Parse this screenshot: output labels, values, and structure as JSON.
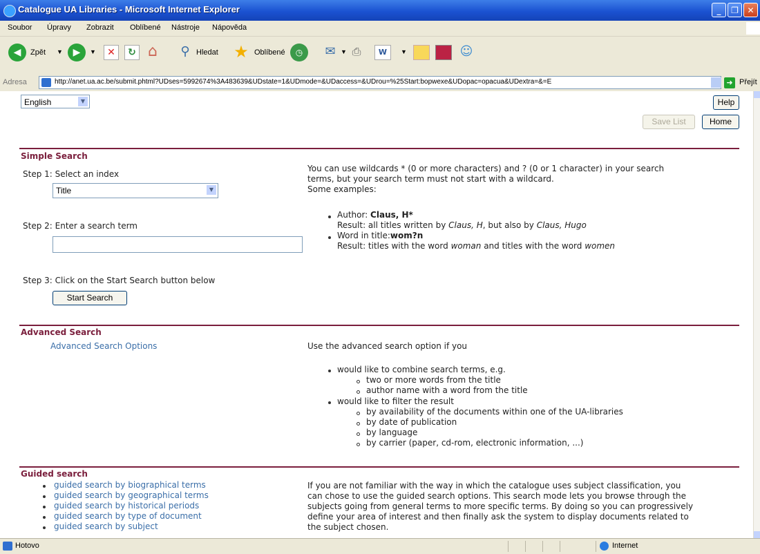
{
  "window": {
    "title": "Catalogue UA Libraries - Microsoft Internet Explorer"
  },
  "menu": [
    "Soubor",
    "Úpravy",
    "Zobrazit",
    "Oblíbené",
    "Nástroje",
    "Nápověda"
  ],
  "toolbar": {
    "back": "Zpět",
    "search": "Hledat",
    "favorites": "Oblíbené"
  },
  "address": {
    "label": "Adresa",
    "url": "http://anet.ua.ac.be/submit.phtml?UDses=5992674%3A483639&UDstate=1&UDmode=&UDaccess=&UDrou=%25Start:bopwexe&UDopac=opacua&UDextra=&=E",
    "go": "Přejít"
  },
  "page": {
    "language": "English",
    "help": "Help",
    "save_list": "Save List",
    "home": "Home",
    "simple": {
      "heading": "Simple Search",
      "step1": "Step 1: Select an index",
      "index_value": "Title",
      "step2": "Step 2: Enter a search term",
      "step3": "Step 3: Click on the Start Search button below",
      "start": "Start Search",
      "help_line1": "You can use wildcards * (0 or more characters) and ? (0 or 1 character) in your search",
      "help_line2": "terms, but your search term must not start with a wildcard.",
      "help_line3": "Some examples:",
      "ex1_label": "Author: ",
      "ex1_term": "Claus, H*",
      "ex1_result_prefix": "Result: all titles written by ",
      "ex1_result_name1": "Claus, H",
      "ex1_result_mid": ", but also by ",
      "ex1_result_name2": "Claus, Hugo",
      "ex2_label": "Word in title:",
      "ex2_term": "wom?n",
      "ex2_result_prefix": "Result: titles with the word ",
      "ex2_result_w1": "woman",
      "ex2_result_mid": " and titles with the word ",
      "ex2_result_w2": "women"
    },
    "advanced": {
      "heading": "Advanced Search",
      "link": "Advanced Search Options",
      "intro": "Use the advanced search option if you",
      "b1": "would like to combine search terms, e.g.",
      "b1a": "two or more words from the title",
      "b1b": "author name with a word from the title",
      "b2": "would like to filter the result",
      "b2a": "by availability of the documents within one of the UA-libraries",
      "b2b": "by date of publication",
      "b2c": "by language",
      "b2d": "by carrier (paper, cd-rom, electronic information, ...)"
    },
    "guided": {
      "heading": "Guided search",
      "links": [
        "guided search by biographical terms",
        "guided search by geographical terms",
        "guided search by historical periods",
        "guided search by type of document",
        "guided search by subject"
      ],
      "desc": [
        "If you are not familiar with the way in which the catalogue uses subject classification, you",
        "can chose to use the guided search options. This search mode lets you browse through the",
        "subjects going from general terms to more specific terms. By doing so you can progressively",
        "define your area of interest and then finally ask the system to display documents related to",
        "the subject chosen."
      ]
    }
  },
  "status": {
    "text": "Hotovo",
    "zone": "Internet"
  }
}
